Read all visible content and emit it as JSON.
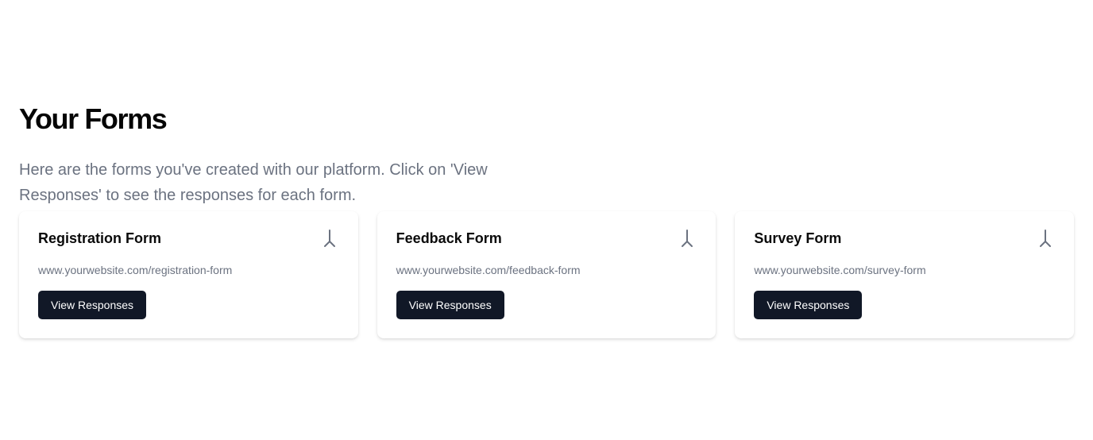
{
  "header": {
    "title": "Your Forms",
    "description": "Here are the forms you've created with our platform. Click on 'View Responses' to see the responses for each form."
  },
  "forms": [
    {
      "name": "Registration Form",
      "url": "www.yourwebsite.com/registration-form",
      "button_label": "View Responses",
      "icon": "merge-icon"
    },
    {
      "name": "Feedback Form",
      "url": "www.yourwebsite.com/feedback-form",
      "button_label": "View Responses",
      "icon": "merge-icon"
    },
    {
      "name": "Survey Form",
      "url": "www.yourwebsite.com/survey-form",
      "button_label": "View Responses",
      "icon": "merge-icon"
    }
  ],
  "colors": {
    "button_bg": "#111827",
    "muted_text": "#6b7280",
    "icon": "#6b7280"
  }
}
